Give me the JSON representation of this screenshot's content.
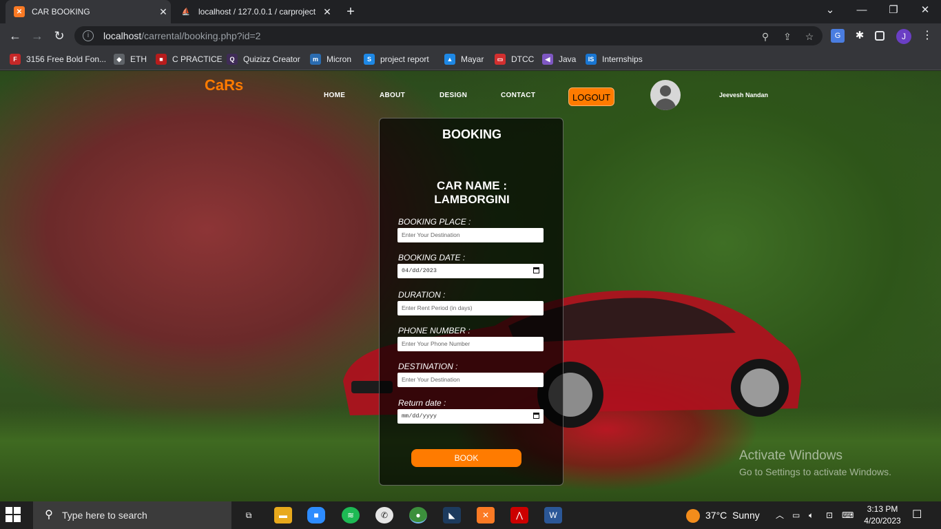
{
  "browser": {
    "tabs": [
      {
        "title": "CAR BOOKING",
        "active": true
      },
      {
        "title": "localhost / 127.0.0.1 / carproject",
        "active": false
      }
    ],
    "url_host": "localhost",
    "url_path": "/carrental/booking.php?id=2",
    "profile_initial": "J",
    "bookmarks": [
      {
        "label": "3156 Free Bold Fon...",
        "icon": "font-icon",
        "color": "#c62828"
      },
      {
        "label": "ETH",
        "icon": "ethereum-icon",
        "color": "#5f6368"
      },
      {
        "label": "C PRACTICE",
        "icon": "folder-icon",
        "color": "#b71c1c"
      },
      {
        "label": "Quizizz Creator",
        "icon": "quizizz-icon",
        "color": "#3f2b57"
      },
      {
        "label": "Micron",
        "icon": "micron-icon",
        "color": "#2b6cb0"
      },
      {
        "label": "project report",
        "icon": "s-icon",
        "color": "#1e88e5"
      },
      {
        "label": "Mayar",
        "icon": "image-icon",
        "color": "#1e88e5"
      },
      {
        "label": "DTCC",
        "icon": "dtcc-icon",
        "color": "#d32f2f"
      },
      {
        "label": "Java",
        "icon": "java-icon",
        "color": "#7e57c2"
      },
      {
        "label": "Internships",
        "icon": "is-icon",
        "color": "#1976d2"
      }
    ]
  },
  "site": {
    "brand": "CaRs",
    "nav": [
      "HOME",
      "ABOUT",
      "DESIGN",
      "CONTACT"
    ],
    "logout_label": "LOGOUT",
    "user_name": "Jeevesh Nandan",
    "accent_color": "#ff7b00"
  },
  "booking": {
    "heading": "BOOKING",
    "car_name_label": "CAR NAME :",
    "car_name": "LAMBORGINI",
    "fields": [
      {
        "label": "BOOKING PLACE :",
        "placeholder": "Enter Your Destination",
        "type": "text"
      },
      {
        "label": "BOOKING DATE :",
        "value": "04/dd/2023",
        "type": "date"
      },
      {
        "label": "DURATION :",
        "placeholder": "Enter Rent Period (in days)",
        "type": "text"
      },
      {
        "label": "PHONE NUMBER :",
        "placeholder": "Enter Your Phone Number",
        "type": "text"
      },
      {
        "label": "DESTINATION :",
        "placeholder": "Enter Your Destination",
        "type": "text"
      },
      {
        "label": "Return date :",
        "value": "mm/dd/yyyy",
        "type": "date"
      }
    ],
    "submit_label": "BOOK"
  },
  "watermark": {
    "line1": "Activate Windows",
    "line2": "Go to Settings to activate Windows."
  },
  "taskbar": {
    "search_placeholder": "Type here to search",
    "weather_temp": "37°C",
    "weather_text": "Sunny",
    "time": "3:13 PM",
    "date": "4/20/2023"
  }
}
